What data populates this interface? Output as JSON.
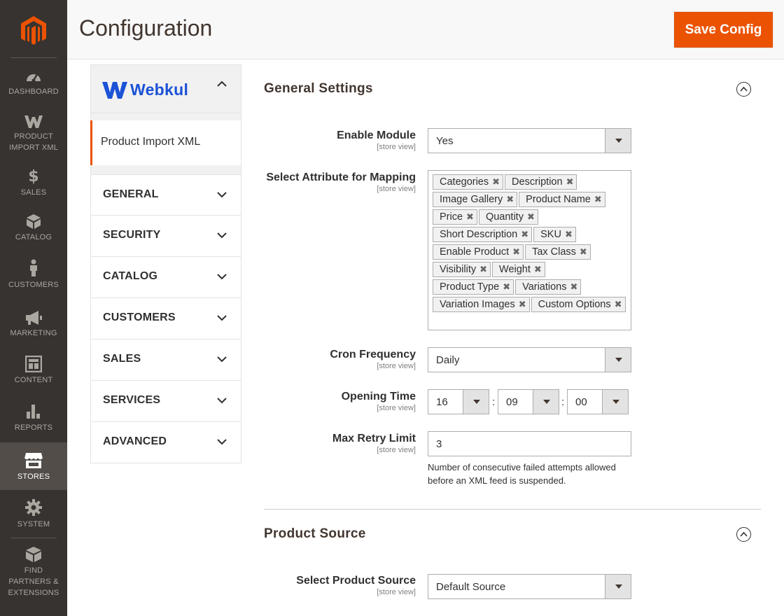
{
  "nav": {
    "items": [
      {
        "label": "DASHBOARD",
        "icon": "dashboard-icon"
      },
      {
        "label": "PRODUCT IMPORT XML",
        "icon": "webkul-w-icon"
      },
      {
        "label": "SALES",
        "icon": "dollar-icon"
      },
      {
        "label": "CATALOG",
        "icon": "cube-icon"
      },
      {
        "label": "CUSTOMERS",
        "icon": "person-icon"
      },
      {
        "label": "MARKETING",
        "icon": "megaphone-icon"
      },
      {
        "label": "CONTENT",
        "icon": "content-icon"
      },
      {
        "label": "REPORTS",
        "icon": "bar-chart-icon"
      },
      {
        "label": "STORES",
        "icon": "store-icon"
      },
      {
        "label": "SYSTEM",
        "icon": "gear-icon"
      },
      {
        "label": "FIND PARTNERS & EXTENSIONS",
        "icon": "box-icon"
      }
    ],
    "active": "STORES"
  },
  "header": {
    "title": "Configuration",
    "save_label": "Save Config"
  },
  "tabs": {
    "brand": "Webkul",
    "sub_item": "Product Import XML",
    "groups": [
      "GENERAL",
      "SECURITY",
      "CATALOG",
      "CUSTOMERS",
      "SALES",
      "SERVICES",
      "ADVANCED"
    ]
  },
  "general": {
    "title": "General Settings",
    "scope": "[store view]",
    "enable_module": {
      "label": "Enable Module",
      "value": "Yes"
    },
    "mapping": {
      "label": "Select Attribute for Mapping",
      "chips": [
        "Categories",
        "Description",
        "Image Gallery",
        "Product Name",
        "Price",
        "Quantity",
        "Short Description",
        "SKU",
        "Enable Product",
        "Tax Class",
        "Visibility",
        "Weight",
        "Product Type",
        "Variations",
        "Variation Images",
        "Custom Options"
      ]
    },
    "cron": {
      "label": "Cron Frequency",
      "value": "Daily"
    },
    "opening_time": {
      "label": "Opening Time",
      "hour": "16",
      "minute": "09",
      "second": "00"
    },
    "retry": {
      "label": "Max Retry Limit",
      "value": "3",
      "note": "Number of consecutive failed attempts allowed before an XML feed is suspended."
    }
  },
  "product_source": {
    "title": "Product Source",
    "scope": "[store view]",
    "select": {
      "label": "Select Product Source",
      "value": "Default Source"
    }
  },
  "colors": {
    "accent": "#eb5202",
    "nav_bg": "#373330",
    "brand_blue": "#1b52d6"
  }
}
